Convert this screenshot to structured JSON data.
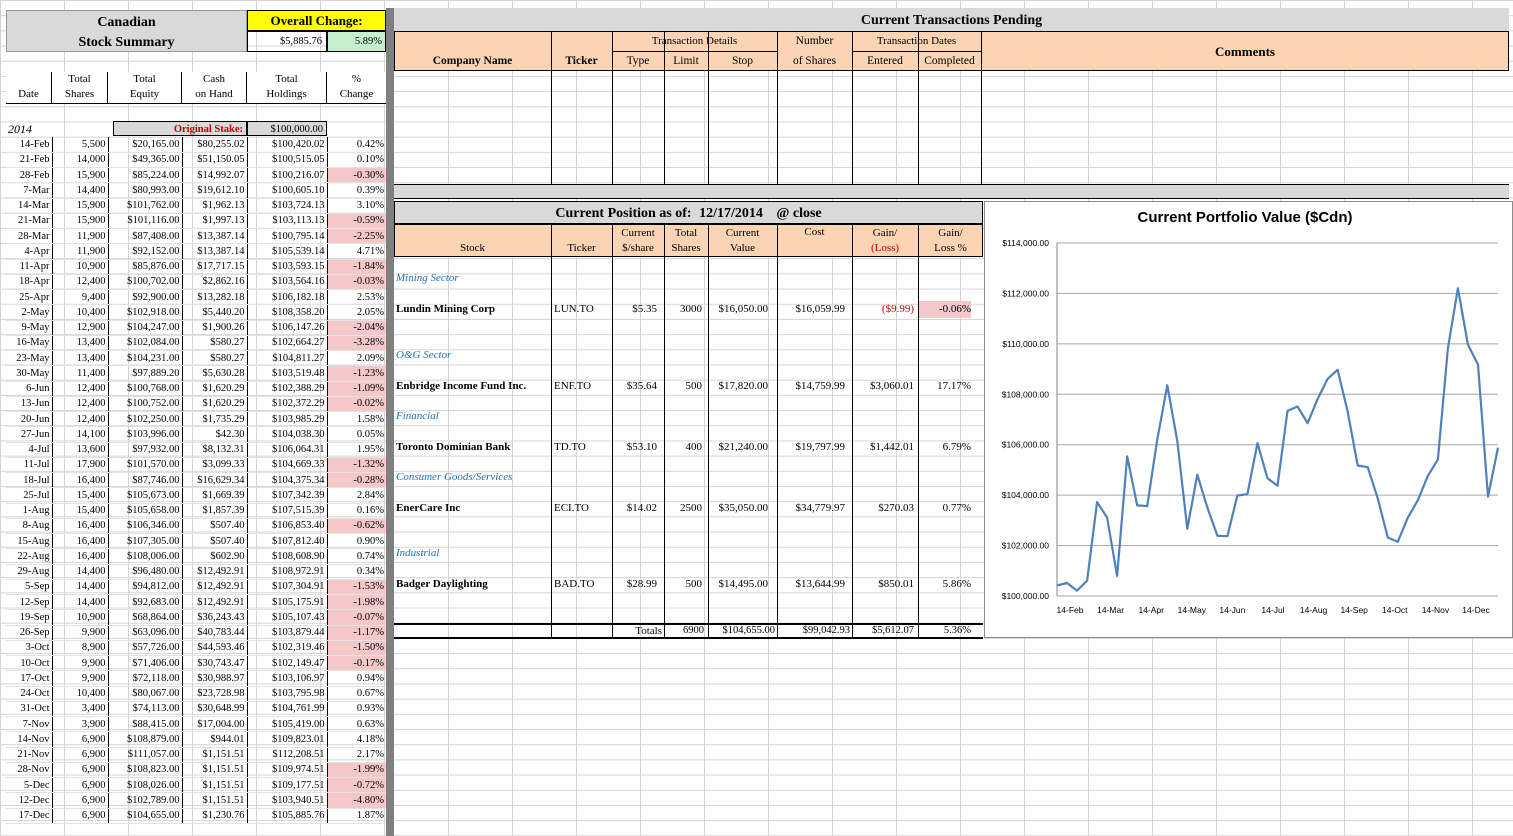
{
  "summary": {
    "title_line1": "Canadian",
    "title_line2": "Stock Summary",
    "overall_change_label": "Overall Change:",
    "overall_change_amount": "$5,885.76",
    "overall_change_pct": "5.89%",
    "col_date": "Date",
    "col_shares": [
      "Total",
      "Shares"
    ],
    "col_equity": [
      "Total",
      "Equity"
    ],
    "col_cash": [
      "Cash",
      "on Hand"
    ],
    "col_holdings": [
      "Total",
      "Holdings"
    ],
    "col_change": [
      "%",
      "Change"
    ],
    "year": "2014",
    "original_stake_label": "Original Stake:",
    "original_stake_value": "$100,000.00",
    "rows": [
      [
        "14-Feb",
        "5,500",
        "$20,165.00",
        "$80,255.02",
        "$100,420.02",
        "0.42%",
        false
      ],
      [
        "21-Feb",
        "14,000",
        "$49,365.00",
        "$51,150.05",
        "$100,515.05",
        "0.10%",
        false
      ],
      [
        "28-Feb",
        "15,900",
        "$85,224.00",
        "$14,992.07",
        "$100,216.07",
        "-0.30%",
        true
      ],
      [
        "7-Mar",
        "14,400",
        "$80,993.00",
        "$19,612.10",
        "$100,605.10",
        "0.39%",
        false
      ],
      [
        "14-Mar",
        "15,900",
        "$101,762.00",
        "$1,962.13",
        "$103,724.13",
        "3.10%",
        false
      ],
      [
        "21-Mar",
        "15,900",
        "$101,116.00",
        "$1,997.13",
        "$103,113.13",
        "-0.59%",
        true
      ],
      [
        "28-Mar",
        "11,900",
        "$87,408.00",
        "$13,387.14",
        "$100,795.14",
        "-2.25%",
        true
      ],
      [
        "4-Apr",
        "11,900",
        "$92,152.00",
        "$13,387.14",
        "$105,539.14",
        "4.71%",
        false
      ],
      [
        "11-Apr",
        "10,900",
        "$85,876.00",
        "$17,717.15",
        "$103,593.15",
        "-1.84%",
        true
      ],
      [
        "18-Apr",
        "12,400",
        "$100,702.00",
        "$2,862.16",
        "$103,564.16",
        "-0.03%",
        true
      ],
      [
        "25-Apr",
        "9,400",
        "$92,900.00",
        "$13,282.18",
        "$106,182.18",
        "2.53%",
        false
      ],
      [
        "2-May",
        "10,400",
        "$102,918.00",
        "$5,440.20",
        "$108,358.20",
        "2.05%",
        false
      ],
      [
        "9-May",
        "12,900",
        "$104,247.00",
        "$1,900.26",
        "$106,147.26",
        "-2.04%",
        true
      ],
      [
        "16-May",
        "13,400",
        "$102,084.00",
        "$580.27",
        "$102,664.27",
        "-3.28%",
        true
      ],
      [
        "23-May",
        "13,400",
        "$104,231.00",
        "$580.27",
        "$104,811.27",
        "2.09%",
        false
      ],
      [
        "30-May",
        "11,400",
        "$97,889.20",
        "$5,630.28",
        "$103,519.48",
        "-1.23%",
        true
      ],
      [
        "6-Jun",
        "12,400",
        "$100,768.00",
        "$1,620.29",
        "$102,388.29",
        "-1.09%",
        true
      ],
      [
        "13-Jun",
        "12,400",
        "$100,752.00",
        "$1,620.29",
        "$102,372.29",
        "-0.02%",
        true
      ],
      [
        "20-Jun",
        "12,400",
        "$102,250.00",
        "$1,735.29",
        "$103,985.29",
        "1.58%",
        false
      ],
      [
        "27-Jun",
        "14,100",
        "$103,996.00",
        "$42.30",
        "$104,038.30",
        "0.05%",
        false
      ],
      [
        "4-Jul",
        "13,600",
        "$97,932.00",
        "$8,132.31",
        "$106,064.31",
        "1.95%",
        false
      ],
      [
        "11-Jul",
        "17,900",
        "$101,570.00",
        "$3,099.33",
        "$104,669.33",
        "-1.32%",
        true
      ],
      [
        "18-Jul",
        "16,400",
        "$87,746.00",
        "$16,629.34",
        "$104,375.34",
        "-0.28%",
        true
      ],
      [
        "25-Jul",
        "15,400",
        "$105,673.00",
        "$1,669.39",
        "$107,342.39",
        "2.84%",
        false
      ],
      [
        "1-Aug",
        "15,400",
        "$105,658.00",
        "$1,857.39",
        "$107,515.39",
        "0.16%",
        false
      ],
      [
        "8-Aug",
        "16,400",
        "$106,346.00",
        "$507.40",
        "$106,853.40",
        "-0.62%",
        true
      ],
      [
        "15-Aug",
        "16,400",
        "$107,305.00",
        "$507.40",
        "$107,812.40",
        "0.90%",
        false
      ],
      [
        "22-Aug",
        "16,400",
        "$108,006.00",
        "$602.90",
        "$108,608.90",
        "0.74%",
        false
      ],
      [
        "29-Aug",
        "14,400",
        "$96,480.00",
        "$12,492.91",
        "$108,972.91",
        "0.34%",
        false
      ],
      [
        "5-Sep",
        "14,400",
        "$94,812.00",
        "$12,492.91",
        "$107,304.91",
        "-1.53%",
        true
      ],
      [
        "12-Sep",
        "14,400",
        "$92,683.00",
        "$12,492.91",
        "$105,175.91",
        "-1.98%",
        true
      ],
      [
        "19-Sep",
        "10,900",
        "$68,864.00",
        "$36,243.43",
        "$105,107.43",
        "-0.07%",
        true
      ],
      [
        "26-Sep",
        "9,900",
        "$63,096.00",
        "$40,783.44",
        "$103,879.44",
        "-1.17%",
        true
      ],
      [
        "3-Oct",
        "8,900",
        "$57,726.00",
        "$44,593.46",
        "$102,319.46",
        "-1.50%",
        true
      ],
      [
        "10-Oct",
        "9,900",
        "$71,406.00",
        "$30,743.47",
        "$102,149.47",
        "-0.17%",
        true
      ],
      [
        "17-Oct",
        "9,900",
        "$72,118.00",
        "$30,988.97",
        "$103,106.97",
        "0.94%",
        false
      ],
      [
        "24-Oct",
        "10,400",
        "$80,067.00",
        "$23,728.98",
        "$103,795.98",
        "0.67%",
        false
      ],
      [
        "31-Oct",
        "3,400",
        "$74,113.00",
        "$30,648.99",
        "$104,761.99",
        "0.93%",
        false
      ],
      [
        "7-Nov",
        "3,900",
        "$88,415.00",
        "$17,004.00",
        "$105,419.00",
        "0.63%",
        false
      ],
      [
        "14-Nov",
        "6,900",
        "$108,879.00",
        "$944.01",
        "$109,823.01",
        "4.18%",
        false
      ],
      [
        "21-Nov",
        "6,900",
        "$111,057.00",
        "$1,151.51",
        "$112,208.51",
        "2.17%",
        false
      ],
      [
        "28-Nov",
        "6,900",
        "$108,823.00",
        "$1,151.51",
        "$109,974.51",
        "-1.99%",
        true
      ],
      [
        "5-Dec",
        "6,900",
        "$108,026.00",
        "$1,151.51",
        "$109,177.51",
        "-0.72%",
        true
      ],
      [
        "12-Dec",
        "6,900",
        "$102,789.00",
        "$1,151.51",
        "$103,940.51",
        "-4.80%",
        true
      ],
      [
        "17-Dec",
        "6,900",
        "$104,655.00",
        "$1,230.76",
        "$105,885.76",
        "1.87%",
        false
      ]
    ]
  },
  "pending": {
    "title": "Current Transactions Pending",
    "company_name": "Company Name",
    "ticker": "Ticker",
    "transaction_details": "Transaction Details",
    "type": "Type",
    "limit": "Limit",
    "stop": "Stop",
    "number": "Number",
    "of_shares": "of Shares",
    "transaction_dates": "Transaction Dates",
    "entered": "Entered",
    "completed": "Completed",
    "comments": "Comments"
  },
  "position": {
    "title": "Current Position as of:",
    "date": "12/17/2014",
    "suffix": "@ close",
    "col_stock": "Stock",
    "col_ticker": "Ticker",
    "col_current_price": [
      "Current",
      "$/share"
    ],
    "col_total_shares": [
      "Total",
      "Shares"
    ],
    "col_current_value": [
      "Current",
      "Value"
    ],
    "col_cost": "Cost",
    "col_gain": [
      "Gain/",
      "(Loss)"
    ],
    "col_gain_pct": [
      "Gain/",
      "Loss %"
    ],
    "sectors": [
      {
        "sector": "Mining Sector",
        "stock": "Lundin Mining Corp",
        "ticker": "LUN.TO",
        "price": "$5.35",
        "shares": "3000",
        "value": "$16,050.00",
        "cost": "$16,059.99",
        "gain": "($9.99)",
        "gain_pct": "-0.06%"
      },
      {
        "sector": "O&G Sector",
        "stock": "Enbridge Income Fund Inc.",
        "ticker": "ENF.TO",
        "price": "$35.64",
        "shares": "500",
        "value": "$17,820.00",
        "cost": "$14,759.99",
        "gain": "$3,060.01",
        "gain_pct": "17.17%"
      },
      {
        "sector": "Financial",
        "stock": "Toronto Dominian Bank",
        "ticker": "TD.TO",
        "price": "$53.10",
        "shares": "400",
        "value": "$21,240.00",
        "cost": "$19,797.99",
        "gain": "$1,442.01",
        "gain_pct": "6.79%"
      },
      {
        "sector": "Consumer Goods/Services",
        "stock": "EnerCare Inc",
        "ticker": "ECI.TO",
        "price": "$14.02",
        "shares": "2500",
        "value": "$35,050.00",
        "cost": "$34,779.97",
        "gain": "$270.03",
        "gain_pct": "0.77%"
      },
      {
        "sector": "Industrial",
        "stock": "Badger Daylighting",
        "ticker": "BAD.TO",
        "price": "$28.99",
        "shares": "500",
        "value": "$14,495.00",
        "cost": "$13,644.99",
        "gain": "$850.01",
        "gain_pct": "5.86%"
      }
    ],
    "totals_label": "Totals",
    "total_shares": "6900",
    "total_value": "$104,655.00",
    "total_cost": "$99,042.93",
    "total_gain": "$5,612.07",
    "total_gain_pct": "5.36%"
  },
  "chart_data": {
    "type": "line",
    "title": "Current Portfolio Value ($Cdn)",
    "xlabel": "",
    "ylabel": "",
    "ylim": [
      100000,
      114000
    ],
    "yticks": [
      "$100,000.00",
      "$102,000.00",
      "$104,000.00",
      "$106,000.00",
      "$108,000.00",
      "$110,000.00",
      "$112,000.00",
      "$114,000.00"
    ],
    "xticks": [
      "14-Feb",
      "14-Mar",
      "14-Apr",
      "14-May",
      "14-Jun",
      "14-Jul",
      "14-Aug",
      "14-Sep",
      "14-Oct",
      "14-Nov",
      "14-Dec"
    ],
    "line_color": "#4f81bd",
    "series": [
      {
        "x": [
          "14-Feb",
          "21-Feb",
          "28-Feb",
          "7-Mar",
          "14-Mar",
          "21-Mar",
          "28-Mar",
          "4-Apr",
          "11-Apr",
          "18-Apr",
          "25-Apr",
          "2-May",
          "9-May",
          "16-May",
          "23-May",
          "30-May",
          "6-Jun",
          "13-Jun",
          "20-Jun",
          "27-Jun",
          "4-Jul",
          "11-Jul",
          "18-Jul",
          "25-Jul",
          "1-Aug",
          "8-Aug",
          "15-Aug",
          "22-Aug",
          "29-Aug",
          "5-Sep",
          "12-Sep",
          "19-Sep",
          "26-Sep",
          "3-Oct",
          "10-Oct",
          "17-Oct",
          "24-Oct",
          "31-Oct",
          "7-Nov",
          "14-Nov",
          "21-Nov",
          "28-Nov",
          "5-Dec",
          "12-Dec",
          "17-Dec"
        ],
        "values": [
          100420.02,
          100515.05,
          100216.07,
          100605.1,
          103724.13,
          103113.13,
          100795.14,
          105539.14,
          103593.15,
          103564.16,
          106182.18,
          108358.2,
          106147.26,
          102664.27,
          104811.27,
          103519.48,
          102388.29,
          102372.29,
          103985.29,
          104038.3,
          106064.31,
          104669.33,
          104375.34,
          107342.39,
          107515.39,
          106853.4,
          107812.4,
          108608.9,
          108972.91,
          107304.91,
          105175.91,
          105107.43,
          103879.44,
          102319.46,
          102149.47,
          103106.97,
          103795.98,
          104761.99,
          105419.0,
          109823.01,
          112208.51,
          109974.51,
          109177.51,
          103940.51,
          105885.76
        ]
      }
    ]
  }
}
